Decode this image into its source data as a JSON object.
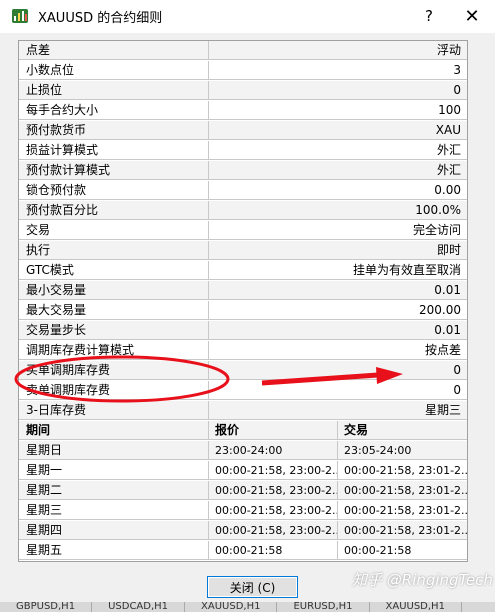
{
  "window": {
    "title": "XAUUSD 的合约细则",
    "help": "?",
    "close": "✕",
    "icon": "chart-app-icon"
  },
  "properties": [
    {
      "label": "点差",
      "value": "浮动"
    },
    {
      "label": "小数点位",
      "value": "3"
    },
    {
      "label": "止损位",
      "value": "0"
    },
    {
      "label": "每手合约大小",
      "value": "100"
    },
    {
      "label": "预付款货币",
      "value": "XAU"
    },
    {
      "label": "损益计算模式",
      "value": "外汇"
    },
    {
      "label": "预付款计算模式",
      "value": "外汇"
    },
    {
      "label": "锁仓预付款",
      "value": "0.00"
    },
    {
      "label": "预付款百分比",
      "value": "100.0%"
    },
    {
      "label": "交易",
      "value": "完全访问"
    },
    {
      "label": "执行",
      "value": "即时"
    },
    {
      "label": "GTC模式",
      "value": "挂单为有效直至取消"
    },
    {
      "label": "最小交易量",
      "value": "0.01"
    },
    {
      "label": "最大交易量",
      "value": "200.00"
    },
    {
      "label": "交易量步长",
      "value": "0.01"
    },
    {
      "label": "调期库存费计算模式",
      "value": "按点差"
    },
    {
      "label": "买单调期库存费",
      "value": "0"
    },
    {
      "label": "卖单调期库存费",
      "value": "0"
    },
    {
      "label": "3-日库存费",
      "value": "星期三"
    }
  ],
  "sessions": {
    "headers": {
      "period": "期间",
      "quote": "报价",
      "trade": "交易"
    },
    "rows": [
      {
        "day": "星期日",
        "quote": "23:00-24:00",
        "trade": "23:05-24:00"
      },
      {
        "day": "星期一",
        "quote": "00:00-21:58, 23:00-2...",
        "trade": "00:00-21:58, 23:01-2..."
      },
      {
        "day": "星期二",
        "quote": "00:00-21:58, 23:00-2...",
        "trade": "00:00-21:58, 23:01-2..."
      },
      {
        "day": "星期三",
        "quote": "00:00-21:58, 23:00-2...",
        "trade": "00:00-21:58, 23:01-2..."
      },
      {
        "day": "星期四",
        "quote": "00:00-21:58, 23:00-2...",
        "trade": "00:00-21:58, 23:01-2..."
      },
      {
        "day": "星期五",
        "quote": "00:00-21:58",
        "trade": "00:00-21:58"
      }
    ]
  },
  "footer": {
    "close_label": "关闭 (C)"
  },
  "watermark": "知乎 @RingingTech",
  "tabs": [
    "GBPUSD,H1",
    "USDCAD,H1",
    "XAUUSD,H1",
    "EURUSD,H1",
    "XAUUSD,H1"
  ],
  "annotation": {
    "color": "#e8111b"
  }
}
